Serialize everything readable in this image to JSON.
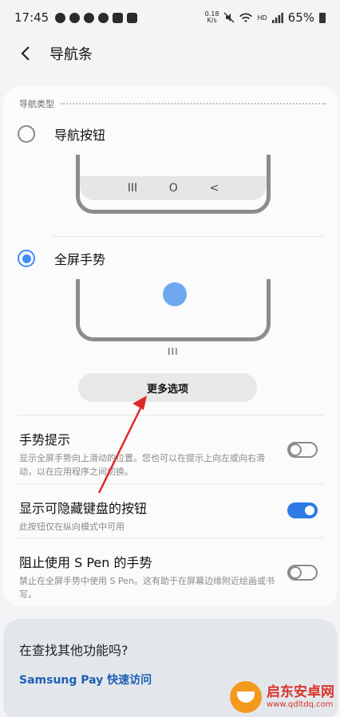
{
  "status_bar": {
    "time": "17:45",
    "net_speed_value": "0.18",
    "net_speed_unit": "K/s",
    "hd_label": "HD",
    "battery": "65%"
  },
  "app_bar": {
    "title": "导航条"
  },
  "nav_type": {
    "section_label": "导航类型",
    "option_buttons": "导航按钮",
    "option_gestures": "全屏手势",
    "nav_glyphs": [
      "III",
      "O",
      "<"
    ],
    "gesture_hint": "III",
    "more_options": "更多选项"
  },
  "settings": [
    {
      "title": "手势提示",
      "desc": "显示全屏手势向上滑动的位置。您也可以在提示上向左或向右滑动，以在应用程序之间切换。",
      "on": false
    },
    {
      "title": "显示可隐藏键盘的按钮",
      "desc": "此按钮仅在纵向模式中可用",
      "on": true
    },
    {
      "title": "阻止使用 S Pen 的手势",
      "desc": "禁止在全屏手势中使用 S Pen。这有助于在屏幕边缘附近绘画或书写。",
      "on": false
    }
  ],
  "other": {
    "title": "在查找其他功能吗?",
    "link": "Samsung Pay 快速访问"
  },
  "watermark": {
    "title": "启东安卓网",
    "url": "www.qdltdq.com"
  },
  "colors": {
    "accent": "#3e8ef7",
    "toggle_on": "#2f7ae5",
    "annotation": "#e0282c"
  }
}
